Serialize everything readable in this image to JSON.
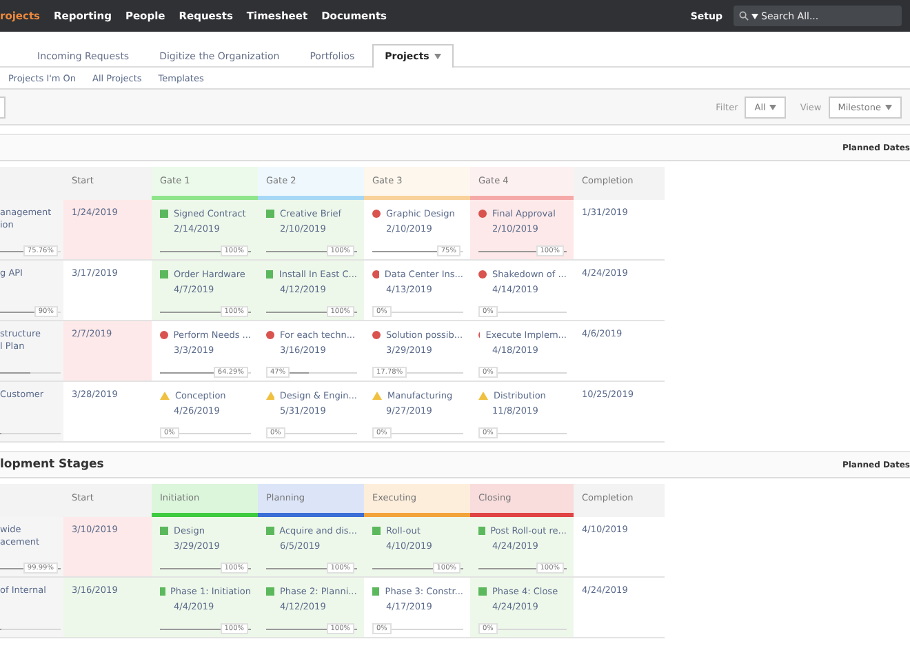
{
  "top_nav": {
    "items": [
      {
        "label": "rojects",
        "selected": true
      },
      {
        "label": "Reporting",
        "selected": false
      },
      {
        "label": "People",
        "selected": false
      },
      {
        "label": "Requests",
        "selected": false
      },
      {
        "label": "Timesheet",
        "selected": false
      },
      {
        "label": "Documents",
        "selected": false
      }
    ],
    "setup": "Setup",
    "search": {
      "placeholder": "Search All..."
    }
  },
  "tabs": [
    {
      "label": "Incoming Requests",
      "selected": false
    },
    {
      "label": "Digitize the Organization",
      "selected": false
    },
    {
      "label": "Portfolios",
      "selected": false
    },
    {
      "label": "Projects",
      "selected": true
    }
  ],
  "subnav": [
    "Projects I'm On",
    "All Projects",
    "Templates"
  ],
  "toolbar": {
    "filter_label": "Filter",
    "filter_value": "All",
    "view_label": "View",
    "view_value": "Milestone"
  },
  "sections": [
    {
      "right_label": "Planned Dates",
      "start_header": "Start",
      "completion_header": "Completion",
      "columns": [
        {
          "label": "Gate 1",
          "color": "#8ee58a"
        },
        {
          "label": "Gate 2",
          "color": "#a6d8f6"
        },
        {
          "label": "Gate 3",
          "color": "#f8d29a"
        },
        {
          "label": "Gate 4",
          "color": "#f6a9a9"
        }
      ],
      "rows": [
        {
          "name": [
            "anagement",
            "ion"
          ],
          "name_progress": {
            "level": 0.76,
            "reading": "75.76%"
          },
          "start": {
            "date": "1/24/2019",
            "color": "#fde9e9"
          },
          "completion": "1/31/2019",
          "cells": [
            {
              "kind": "done",
              "title": "Signed Contract",
              "date": "2/14/2019",
              "color": "#eef8ea",
              "level": 1,
              "reading": "100%"
            },
            {
              "kind": "done",
              "title": "Creative Brief",
              "date": "2/10/2019",
              "color": "#eef8ea",
              "level": 1,
              "reading": "100%"
            },
            {
              "kind": "late",
              "title": "Graphic Design",
              "date": "2/10/2019",
              "level": 0.75,
              "reading": "75%"
            },
            {
              "kind": "late",
              "title": "Final Approval",
              "date": "2/10/2019",
              "color": "#fde9e9",
              "level": 1,
              "reading": "100%"
            }
          ]
        },
        {
          "name": [
            "g API"
          ],
          "name_progress": {
            "level": 0.9,
            "reading": "90%"
          },
          "start": {
            "date": "3/17/2019"
          },
          "completion": "4/24/2019",
          "cells": [
            {
              "kind": "done",
              "title": "Order Hardware",
              "date": "4/7/2019",
              "color": "#eef8ea",
              "level": 1,
              "reading": "100%"
            },
            {
              "kind": "done",
              "title": "Install In East C...",
              "date": "4/12/2019",
              "color": "#eef8ea",
              "level": 1,
              "reading": "100%"
            },
            {
              "kind": "late",
              "title": "Data Center Ins...",
              "date": "4/13/2019",
              "level": 0,
              "reading": "0%"
            },
            {
              "kind": "late",
              "title": "Shakedown of ...",
              "date": "4/14/2019",
              "level": 0,
              "reading": "0%"
            }
          ]
        },
        {
          "name": [
            "structure",
            "l Plan"
          ],
          "name_progress": {
            "level": 0.5
          },
          "start": {
            "date": "2/7/2019",
            "color": "#fde9e9"
          },
          "completion": "4/6/2019",
          "cells": [
            {
              "kind": "late",
              "title": "Perform Needs ...",
              "date": "3/3/2019",
              "level": 0.6429,
              "reading": "64.29%"
            },
            {
              "kind": "late",
              "title": "For each techn...",
              "date": "3/16/2019",
              "level": 0.47,
              "reading": "47%"
            },
            {
              "kind": "late",
              "title": "Solution possib...",
              "date": "3/29/2019",
              "level": 0.1778,
              "reading": "17.78%"
            },
            {
              "kind": "late",
              "title": "Execute Implem...",
              "date": "4/18/2019",
              "level": 0,
              "reading": "0%"
            }
          ]
        },
        {
          "name": [
            "Customer"
          ],
          "name_progress": {
            "level": 0
          },
          "start": {
            "date": "3/28/2019"
          },
          "completion": "10/25/2019",
          "cells": [
            {
              "kind": "warning",
              "title": "Conception",
              "date": "4/26/2019",
              "level": 0,
              "reading": "0%"
            },
            {
              "kind": "warning",
              "title": "Design & Engin...",
              "date": "5/31/2019",
              "level": 0,
              "reading": "0%"
            },
            {
              "kind": "warning",
              "title": "Manufacturing",
              "date": "9/27/2019",
              "level": 0,
              "reading": "0%"
            },
            {
              "kind": "warning",
              "title": "Distribution",
              "date": "11/8/2019",
              "level": 0,
              "reading": "0%"
            }
          ]
        }
      ]
    },
    {
      "title": "lopment Stages",
      "right_label": "Planned Dates",
      "start_header": "Start",
      "completion_header": "Completion",
      "columns": [
        {
          "label": "Initiation",
          "color": "#3fcb3f"
        },
        {
          "label": "Planning",
          "color": "#3b6fd6"
        },
        {
          "label": "Executing",
          "color": "#f2a33a"
        },
        {
          "label": "Closing",
          "color": "#e04444"
        }
      ],
      "rows": [
        {
          "name": [
            "wide",
            "acement"
          ],
          "name_progress": {
            "level": 0.9999,
            "reading": "99.99%"
          },
          "start": {
            "date": "3/10/2019",
            "color": "#fde9e9"
          },
          "completion": "4/10/2019",
          "cells": [
            {
              "kind": "done",
              "title": "Design",
              "date": "3/29/2019",
              "color": "#eef8ea",
              "level": 1,
              "reading": "100%"
            },
            {
              "kind": "done",
              "title": "Acquire and dis...",
              "date": "6/5/2019",
              "color": "#eef8ea",
              "level": 1,
              "reading": "100%"
            },
            {
              "kind": "done",
              "title": "Roll-out",
              "date": "4/10/2019",
              "color": "#eef8ea",
              "level": 1,
              "reading": "100%"
            },
            {
              "kind": "done",
              "title": "Post Roll-out re...",
              "date": "4/24/2019",
              "color": "#eef8ea",
              "level": 1,
              "reading": "100%"
            }
          ]
        },
        {
          "name": [
            "of Internal"
          ],
          "name_progress": {
            "level": 0
          },
          "start": {
            "date": "3/16/2019",
            "color": "#eef8ea"
          },
          "completion": "4/24/2019",
          "cells": [
            {
              "kind": "done",
              "title": "Phase 1: Initiation",
              "date": "4/4/2019",
              "color": "#eef8ea",
              "level": 1,
              "reading": "100%"
            },
            {
              "kind": "done",
              "title": "Phase 2: Planni...",
              "date": "4/12/2019",
              "color": "#eef8ea",
              "level": 1,
              "reading": "100%"
            },
            {
              "kind": "done",
              "title": "Phase 3: Constr...",
              "date": "4/17/2019",
              "level": 0,
              "reading": "0%"
            },
            {
              "kind": "done",
              "title": "Phase 4: Close",
              "date": "4/24/2019",
              "color": "#eef8ea",
              "level": 0,
              "reading": "0%"
            }
          ]
        }
      ]
    }
  ]
}
